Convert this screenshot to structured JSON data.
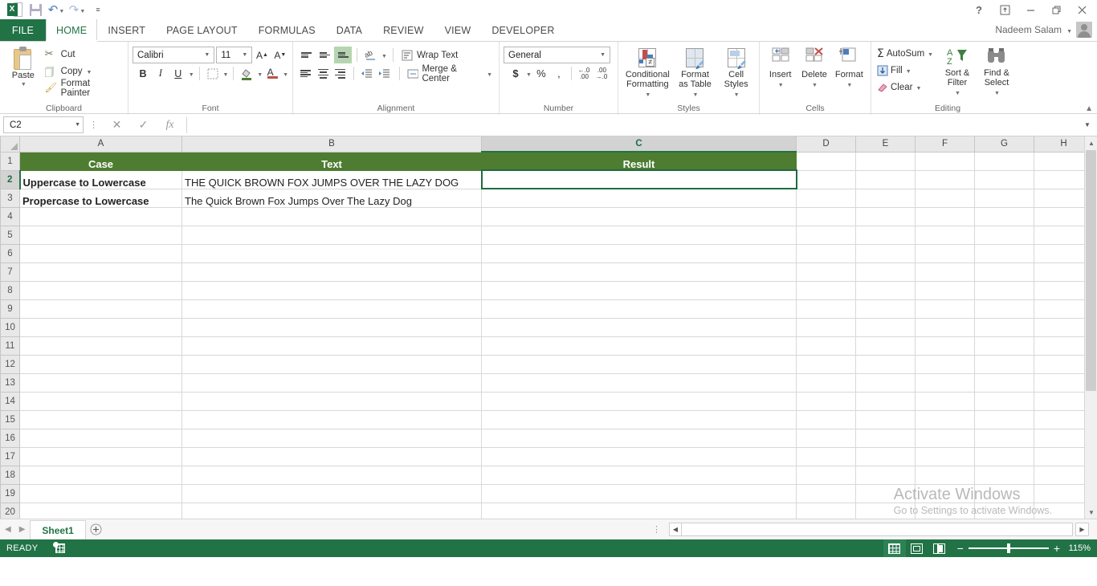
{
  "app": {
    "name": "Microsoft Excel",
    "user_name": "Nadeem Salam",
    "help_icon": "?",
    "ribbon_display_icon": "ribbon-display-options-icon",
    "minimize_icon": "minimize-icon",
    "restore_icon": "restore-icon",
    "close_icon": "close-icon"
  },
  "quick_access": {
    "logo": "excel-logo-icon",
    "save": "save-icon",
    "undo": "undo-icon",
    "redo": "redo-icon",
    "customize": "customize-qat-icon"
  },
  "tabs": {
    "file": "FILE",
    "items": [
      "HOME",
      "INSERT",
      "PAGE LAYOUT",
      "FORMULAS",
      "DATA",
      "REVIEW",
      "VIEW",
      "DEVELOPER"
    ],
    "active": "HOME"
  },
  "ribbon": {
    "clipboard": {
      "label": "Clipboard",
      "paste": "Paste",
      "cut": "Cut",
      "copy": "Copy",
      "format_painter": "Format Painter"
    },
    "font": {
      "label": "Font",
      "font_name": "Calibri",
      "font_size": "11",
      "grow": "A",
      "shrink": "A",
      "bold": "B",
      "italic": "I",
      "underline": "U",
      "borders": "borders-icon",
      "fill_color": "fill-color-icon",
      "font_color": "A"
    },
    "alignment": {
      "label": "Alignment",
      "top_align": "top-align-icon",
      "middle_align": "middle-align-icon",
      "bottom_align": "bottom-align-icon",
      "orientation": "orientation-icon",
      "align_left": "align-left-icon",
      "align_center": "align-center-icon",
      "align_right": "align-right-icon",
      "decrease_indent": "decrease-indent-icon",
      "increase_indent": "increase-indent-icon",
      "wrap_text": "Wrap Text",
      "merge_center": "Merge & Center"
    },
    "number": {
      "label": "Number",
      "format": "General",
      "currency": "$",
      "percent": "%",
      "comma": ",",
      "increase_decimal": "increase-decimal-icon",
      "decrease_decimal": "decrease-decimal-icon"
    },
    "styles": {
      "label": "Styles",
      "conditional_formatting": "Conditional Formatting",
      "format_as_table": "Format as Table",
      "cell_styles": "Cell Styles"
    },
    "cells": {
      "label": "Cells",
      "insert": "Insert",
      "delete": "Delete",
      "format": "Format"
    },
    "editing": {
      "label": "Editing",
      "autosum": "AutoSum",
      "fill": "Fill",
      "clear": "Clear",
      "sort_filter": "Sort & Filter",
      "find_select": "Find & Select"
    },
    "collapse": "collapse-ribbon-icon"
  },
  "formula_bar": {
    "name_box": "C2",
    "cancel_icon": "cancel-icon",
    "enter_icon": "confirm-icon",
    "function_icon": "insert-function-icon",
    "value": "",
    "expand_icon": "expand-formula-bar-icon"
  },
  "grid": {
    "columns": [
      "A",
      "B",
      "C",
      "D",
      "E",
      "F",
      "G",
      "H"
    ],
    "selected_column": "C",
    "selected_row": "2",
    "rows": [
      "1",
      "2",
      "3",
      "4",
      "5",
      "6",
      "7",
      "8",
      "9",
      "10",
      "11",
      "12",
      "13",
      "14",
      "15",
      "16",
      "17",
      "18",
      "19",
      "20"
    ],
    "header_row": {
      "A": "Case",
      "B": "Text",
      "C": "Result"
    },
    "data_rows": [
      {
        "row": "2",
        "A": "Uppercase to Lowercase",
        "B": "THE QUICK BROWN FOX JUMPS OVER THE LAZY DOG",
        "C": ""
      },
      {
        "row": "3",
        "A": "Propercase to Lowercase",
        "B": "The Quick Brown Fox Jumps Over The Lazy Dog",
        "C": ""
      }
    ],
    "active_cell": "C2",
    "header_fill_color": "#4E7C31"
  },
  "watermark": {
    "line1": "Activate Windows",
    "line2": "Go to Settings to activate Windows."
  },
  "sheet_tabs": {
    "prev_icon": "previous-sheet-icon",
    "next_icon": "next-sheet-icon",
    "sheets": [
      "Sheet1"
    ],
    "active_sheet": "Sheet1",
    "add_sheet": "+"
  },
  "status_bar": {
    "status": "READY",
    "macro_record_icon": "record-macro-icon",
    "view_normal": "normal-view-icon",
    "view_page_layout": "page-layout-view-icon",
    "view_page_break": "page-break-preview-icon",
    "zoom_out": "−",
    "zoom_in": "+",
    "zoom_level": "115%"
  },
  "colors": {
    "excel_green": "#217346",
    "header_green": "#4E7C31",
    "selection_green": "#1F6B43",
    "ribbon_bg": "#FFFFFF"
  }
}
